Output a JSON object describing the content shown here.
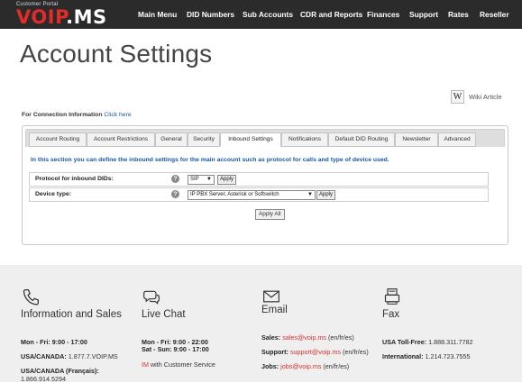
{
  "brand": {
    "top_text": "Customer Portal",
    "logo_text": "VOIP.MS"
  },
  "nav": {
    "items": [
      "Main Menu",
      "DID Numbers",
      "Sub Accounts",
      "CDR and Reports",
      "Finances",
      "Support",
      "Rates",
      "Reseller"
    ]
  },
  "page": {
    "title": "Account Settings",
    "wiki_label": "Wiki Article",
    "connection_label": "For Connection Information",
    "connection_link": "Click here"
  },
  "tabs": [
    "Account Routing",
    "Account Restrictions",
    "General",
    "Security",
    "Inbound Settings",
    "Notifications",
    "Default DID Routing",
    "Newsletter",
    "Advanced"
  ],
  "active_tab": "Inbound Settings",
  "inbound": {
    "intro": "In this section you can define the inbound settings for the main account such as protocol for calls and type of device used.",
    "protocol_label": "Protocol for inbound DIDs:",
    "protocol_value": "SIP",
    "device_label": "Device type:",
    "device_value": "IP PBX Server, Asterisk or Softswitch",
    "apply_label": "Apply",
    "apply_all_label": "Apply All"
  },
  "footer": {
    "info": {
      "title": "Information and Sales",
      "l1_b": "Mon - Fri: 9:00 - 17:00",
      "l2_b": "USA/CANADA:",
      "l2": " 1.877.7.VOIP.MS",
      "l3_b": "USA/CANADA (Français):",
      "l4": "1.866.914.5294"
    },
    "chat": {
      "title": "Live Chat",
      "l1_b": "Mon - Fri: 9:00 - 22:00",
      "l2_b": "Sat - Sun: 9:00 - 17:00",
      "l3_red": "IM",
      "l3": " with Customer Service"
    },
    "email": {
      "title": "Email",
      "l1_b": "Sales:",
      "l1_red": "sales@voip.ms",
      "l1": " (en/fr/es)",
      "l2_b": "Support:",
      "l2_red": "support@voip.ms",
      "l2": " (en/fr/es)",
      "l3_b": "Jobs:",
      "l3_red": "jobs@voip.ms",
      "l3": " (en/fr/es)"
    },
    "fax": {
      "title": "Fax",
      "l1_b": "USA Toll-Free:",
      "l1": " 1.888.311.7782",
      "l2_b": "International:",
      "l2": " 1.214.723.7555"
    }
  },
  "colors": {
    "accent": "#d6322e",
    "nav_bg": "#2b2b2b",
    "link": "#1a56a8"
  }
}
